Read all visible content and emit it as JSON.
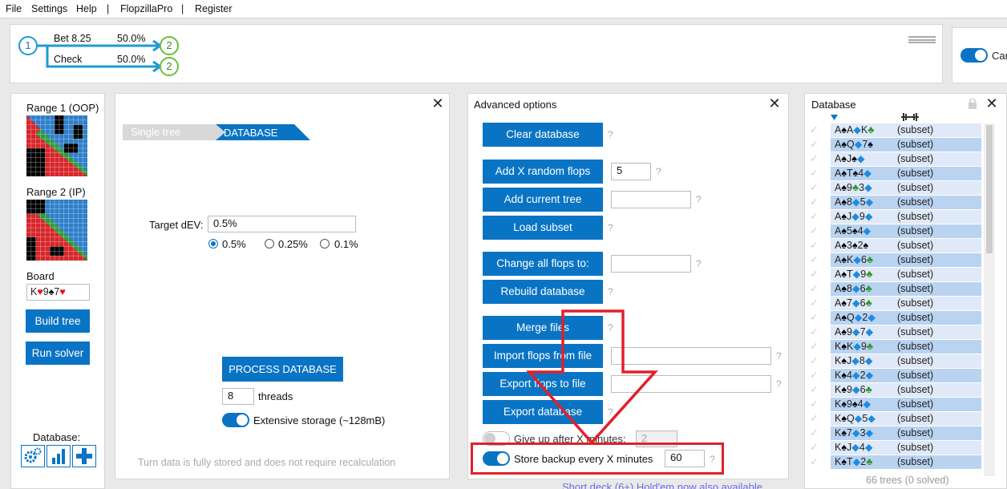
{
  "menu": [
    "File",
    "Settings",
    "Help",
    "|",
    "FlopzillaPro",
    "|",
    "Register"
  ],
  "tree": {
    "root_node": "1",
    "branches": [
      {
        "label": "Bet 8.25",
        "pct": "50.0%",
        "child": "2"
      },
      {
        "label": "Check",
        "pct": "50.0%",
        "child": "2"
      }
    ]
  },
  "top_right": {
    "label": "Car"
  },
  "left_panel": {
    "range1_label": "Range 1 (OOP)",
    "range2_label": "Range 2 (IP)",
    "board_label": "Board",
    "board_cards": [
      {
        "rank": "K",
        "suit": "♥",
        "color": "#e21414"
      },
      {
        "rank": "9",
        "suit": "♠",
        "color": "#000000"
      },
      {
        "rank": "7",
        "suit": "♥",
        "color": "#e21414"
      }
    ],
    "build_tree": "Build tree",
    "run_solver": "Run solver",
    "database_label": "Database:",
    "icons": [
      "gears-icon",
      "bar-chart-icon",
      "plus-icon"
    ]
  },
  "db_panel": {
    "tab_single": "Single tree",
    "tab_database": "DATABASE",
    "target_label": "Target dEV:",
    "target_value": "0.5%",
    "radio_options": [
      {
        "label": "0.5%",
        "checked": true
      },
      {
        "label": "0.25%",
        "checked": false
      },
      {
        "label": "0.1%",
        "checked": false
      }
    ],
    "process_button": "PROCESS DATABASE",
    "threads_value": "8",
    "threads_label": "threads",
    "storage_label": "Extensive storage (~128mB)",
    "storage_on": true,
    "footer_note": "Turn data is fully stored and does not require recalculation"
  },
  "advanced": {
    "title": "Advanced options",
    "clear_database": "Clear database",
    "add_random_flops": "Add X random flops",
    "random_flops_value": "5",
    "add_current_tree": "Add current tree",
    "load_subset": "Load subset",
    "change_all_flops": "Change all flops to:",
    "rebuild_database": "Rebuild database",
    "merge_files": "Merge files",
    "import_flops": "Import flops from file",
    "export_flops": "Export flops to file",
    "export_database": "Export database",
    "give_up_label": "Give up after X minutes:",
    "give_up_value": "2",
    "give_up_on": false,
    "backup_label": "Store backup every X minutes",
    "backup_value": "60",
    "backup_on": true,
    "question_mark": "?"
  },
  "db_list": {
    "title": "Database",
    "status": "66 trees (0 solved)",
    "rows": [
      {
        "cards": [
          [
            "A",
            "♠",
            "#000000"
          ],
          [
            "A",
            "◆",
            "#1f8be0"
          ],
          [
            "K",
            "♣",
            "#2e9a2e"
          ]
        ],
        "tag": "(subset)"
      },
      {
        "cards": [
          [
            "A",
            "♠",
            "#000000"
          ],
          [
            "Q",
            "◆",
            "#1f8be0"
          ],
          [
            "7",
            "♠",
            "#000000"
          ]
        ],
        "tag": "(subset)"
      },
      {
        "cards": [
          [
            "A",
            "♠",
            "#000000"
          ],
          [
            "J",
            "♠",
            "#000000"
          ],
          [
            "",
            "◆",
            "#1f8be0"
          ]
        ],
        "tag": "(subset)"
      },
      {
        "cards": [
          [
            "A",
            "♠",
            "#000000"
          ],
          [
            "T",
            "♠",
            "#000000"
          ],
          [
            "4",
            "◆",
            "#1f8be0"
          ]
        ],
        "tag": "(subset)"
      },
      {
        "cards": [
          [
            "A",
            "♠",
            "#000000"
          ],
          [
            "9",
            "♣",
            "#2e9a2e"
          ],
          [
            "3",
            "◆",
            "#1f8be0"
          ]
        ],
        "tag": "(subset)"
      },
      {
        "cards": [
          [
            "A",
            "♠",
            "#000000"
          ],
          [
            "8",
            "◆",
            "#1f8be0"
          ],
          [
            "5",
            "◆",
            "#1f8be0"
          ]
        ],
        "tag": "(subset)"
      },
      {
        "cards": [
          [
            "A",
            "♠",
            "#000000"
          ],
          [
            "J",
            "◆",
            "#1f8be0"
          ],
          [
            "9",
            "◆",
            "#1f8be0"
          ]
        ],
        "tag": "(subset)"
      },
      {
        "cards": [
          [
            "A",
            "♠",
            "#000000"
          ],
          [
            "5",
            "♠",
            "#000000"
          ],
          [
            "4",
            "◆",
            "#1f8be0"
          ]
        ],
        "tag": "(subset)"
      },
      {
        "cards": [
          [
            "A",
            "♠",
            "#000000"
          ],
          [
            "3",
            "♠",
            "#000000"
          ],
          [
            "2",
            "♠",
            "#000000"
          ]
        ],
        "tag": "(subset)"
      },
      {
        "cards": [
          [
            "A",
            "♠",
            "#000000"
          ],
          [
            "K",
            "◆",
            "#1f8be0"
          ],
          [
            "6",
            "♣",
            "#2e9a2e"
          ]
        ],
        "tag": "(subset)"
      },
      {
        "cards": [
          [
            "A",
            "♠",
            "#000000"
          ],
          [
            "T",
            "◆",
            "#1f8be0"
          ],
          [
            "9",
            "♣",
            "#2e9a2e"
          ]
        ],
        "tag": "(subset)"
      },
      {
        "cards": [
          [
            "A",
            "♠",
            "#000000"
          ],
          [
            "8",
            "◆",
            "#1f8be0"
          ],
          [
            "6",
            "♣",
            "#2e9a2e"
          ]
        ],
        "tag": "(subset)"
      },
      {
        "cards": [
          [
            "A",
            "♠",
            "#000000"
          ],
          [
            "7",
            "◆",
            "#1f8be0"
          ],
          [
            "6",
            "♣",
            "#2e9a2e"
          ]
        ],
        "tag": "(subset)"
      },
      {
        "cards": [
          [
            "A",
            "♠",
            "#000000"
          ],
          [
            "Q",
            "◆",
            "#1f8be0"
          ],
          [
            "2",
            "◆",
            "#1f8be0"
          ]
        ],
        "tag": "(subset)"
      },
      {
        "cards": [
          [
            "A",
            "♠",
            "#000000"
          ],
          [
            "9",
            "◆",
            "#1f8be0"
          ],
          [
            "7",
            "◆",
            "#1f8be0"
          ]
        ],
        "tag": "(subset)"
      },
      {
        "cards": [
          [
            "K",
            "♠",
            "#000000"
          ],
          [
            "K",
            "◆",
            "#1f8be0"
          ],
          [
            "9",
            "♣",
            "#2e9a2e"
          ]
        ],
        "tag": "(subset)"
      },
      {
        "cards": [
          [
            "K",
            "♠",
            "#000000"
          ],
          [
            "J",
            "◆",
            "#1f8be0"
          ],
          [
            "8",
            "◆",
            "#1f8be0"
          ]
        ],
        "tag": "(subset)"
      },
      {
        "cards": [
          [
            "K",
            "♠",
            "#000000"
          ],
          [
            "4",
            "◆",
            "#1f8be0"
          ],
          [
            "2",
            "◆",
            "#1f8be0"
          ]
        ],
        "tag": "(subset)"
      },
      {
        "cards": [
          [
            "K",
            "♠",
            "#000000"
          ],
          [
            "9",
            "◆",
            "#1f8be0"
          ],
          [
            "6",
            "♣",
            "#2e9a2e"
          ]
        ],
        "tag": "(subset)"
      },
      {
        "cards": [
          [
            "K",
            "♠",
            "#000000"
          ],
          [
            "9",
            "♠",
            "#000000"
          ],
          [
            "4",
            "◆",
            "#1f8be0"
          ]
        ],
        "tag": "(subset)"
      },
      {
        "cards": [
          [
            "K",
            "♠",
            "#000000"
          ],
          [
            "Q",
            "◆",
            "#1f8be0"
          ],
          [
            "5",
            "◆",
            "#1f8be0"
          ]
        ],
        "tag": "(subset)"
      },
      {
        "cards": [
          [
            "K",
            "♠",
            "#000000"
          ],
          [
            "7",
            "◆",
            "#1f8be0"
          ],
          [
            "3",
            "◆",
            "#1f8be0"
          ]
        ],
        "tag": "(subset)"
      },
      {
        "cards": [
          [
            "K",
            "♠",
            "#000000"
          ],
          [
            "J",
            "◆",
            "#1f8be0"
          ],
          [
            "4",
            "◆",
            "#1f8be0"
          ]
        ],
        "tag": "(subset)"
      },
      {
        "cards": [
          [
            "K",
            "♠",
            "#000000"
          ],
          [
            "T",
            "◆",
            "#1f8be0"
          ],
          [
            "2",
            "♣",
            "#2e9a2e"
          ]
        ],
        "tag": "(subset)"
      }
    ]
  },
  "footer_link": "Short deck (6+) Hold'em now also available",
  "colors": {
    "accent": "#0a74c4",
    "annotation": "#e0202a",
    "row_a": "#dfe9f7",
    "row_b": "#b9d3f1"
  }
}
